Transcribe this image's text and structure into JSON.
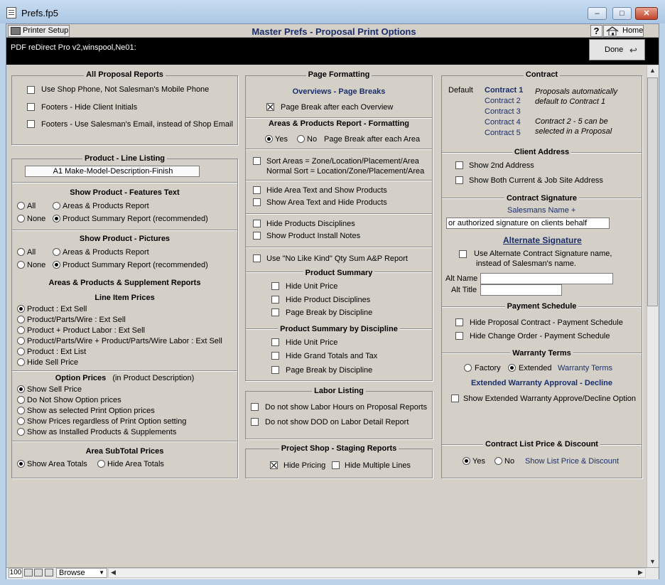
{
  "window": {
    "title": "Prefs.fp5",
    "minimize": "–",
    "maximize": "□",
    "close": "✕"
  },
  "toolbar": {
    "printer_setup": "Printer Setup",
    "page_title": "Master Prefs - Proposal Print Options",
    "help": "?",
    "home": "Home"
  },
  "header": {
    "printer_path": "PDF reDirect Pro v2,winspool,Ne01:",
    "done": "Done"
  },
  "col1": {
    "all_reports": {
      "title": "All Proposal Reports",
      "items": [
        {
          "label": "Use Shop Phone, Not Salesman's Mobile Phone",
          "checked": false
        },
        {
          "label": "Footers - Hide Client Initials",
          "checked": false
        },
        {
          "label": "Footers - Use Salesman's Email, instead of Shop Email",
          "checked": false
        }
      ]
    },
    "line_listing": {
      "title": "Product - Line Listing",
      "value": "A1 Make-Model-Description-Finish"
    },
    "features": {
      "title": "Show Product - Features Text",
      "opt_all": "All",
      "opt_areas": "Areas & Products Report",
      "opt_none": "None",
      "opt_summary": "Product Summary Report (recommended)",
      "selected": "summary"
    },
    "pictures": {
      "title": "Show Product - Pictures",
      "opt_all": "All",
      "opt_areas": "Areas & Products Report",
      "opt_none": "None",
      "opt_summary": "Product Summary Report (recommended)",
      "selected": "summary"
    },
    "supplement": {
      "title": "Areas & Products & Supplement Reports",
      "subtitle": "Line Item Prices",
      "options": [
        "Product : Ext Sell",
        "Product/Parts/Wire : Ext Sell",
        "Product + Product Labor : Ext Sell",
        "Product/Parts/Wire + Product/Parts/Wire Labor : Ext Sell",
        "Product : Ext List",
        "Hide Sell Price"
      ],
      "selected": 0
    },
    "option_prices": {
      "title": "Option Prices",
      "title_note": "(in Product Description)",
      "options": [
        "Show Sell Price",
        "Do Not Show Option prices",
        "Show as selected Print Option prices",
        "Show Prices regardless of Print Option setting",
        "Show as Installed Products & Supplements"
      ],
      "selected": 0
    },
    "subtotal": {
      "title": "Area SubTotal Prices",
      "opt_show": "Show Area Totals",
      "opt_hide": "Hide Area Totals",
      "selected": "show"
    }
  },
  "col2": {
    "page_format": {
      "title": "Page Formatting",
      "subtitle": "Overviews - Page Breaks",
      "page_break_overview": "Page Break after each Overview",
      "page_break_overview_checked": true
    },
    "ap_format": {
      "title": "Areas & Products Report - Formatting",
      "yes": "Yes",
      "no": "No",
      "page_break_area": "Page Break after each Area",
      "selected": "yes",
      "sort_line1": "Sort Areas = Zone/Location/Placement/Area",
      "sort_line2": "Normal Sort = Location/Zone/Placement/Area",
      "hide_area_text": "Hide Area Text and Show Products",
      "show_area_text": "Show Area Text and Hide Products",
      "hide_disciplines": "Hide Products Disciplines",
      "show_install_notes": "Show Product Install Notes",
      "no_like_kind": "Use \"No Like Kind\" Qty Sum A&P Report"
    },
    "summary": {
      "title": "Product Summary",
      "items": [
        "Hide Unit Price",
        "Hide Product Disciplines",
        "Page Break by Discipline"
      ]
    },
    "summary_disc": {
      "title": "Product Summary by Discipline",
      "items": [
        "Hide Unit Price",
        "Hide Grand Totals and Tax",
        "Page Break by Discipline"
      ]
    },
    "labor": {
      "title": "Labor Listing",
      "items": [
        "Do not show Labor Hours on Proposal Reports",
        "Do not show DOD on Labor Detail Report"
      ]
    },
    "staging": {
      "title": "Project Shop - Staging Reports",
      "hide_pricing": "Hide Pricing",
      "hide_pricing_checked": true,
      "hide_multiple": "Hide Multiple Lines"
    }
  },
  "col3": {
    "contract": {
      "title": "Contract",
      "default_label": "Default",
      "contracts": [
        "Contract 1",
        "Contract 2",
        "Contract 3",
        "Contract 4",
        "Contract 5"
      ],
      "note1": "Proposals automatically default to Contract 1",
      "note1a": "Proposals automatically",
      "note1b": "default to Contract 1",
      "note2a": "Contract 2 - 5 can be",
      "note2b": "selected in a Proposal"
    },
    "client_address": {
      "title": "Client Address",
      "items": [
        "Show 2nd Address",
        "Show Both Current & Job Site Address"
      ]
    },
    "signature": {
      "title": "Contract Signature",
      "salesman_label": "Salesmans Name  +",
      "sig_value": "or authorized signature on clients behalf",
      "alt_title": "Alternate Signature",
      "alt_use1": "Use Alternate Contract Signature name,",
      "alt_use2": "instead of Salesman's name.",
      "alt_name": "Alt Name",
      "alt_title_label": "Alt Title"
    },
    "payment": {
      "title": "Payment Schedule",
      "items": [
        "Hide Proposal Contract - Payment Schedule",
        "Hide Change Order - Payment Schedule"
      ]
    },
    "warranty": {
      "title": "Warranty Terms",
      "opt_factory": "Factory",
      "opt_extended": "Extended",
      "terms_label": "Warranty Terms",
      "selected": "extended",
      "approval_title": "Extended Warranty Approval - Decline",
      "approval_option": "Show Extended Warranty Approve/Decline Option"
    },
    "list_price": {
      "title": "Contract List Price & Discount",
      "yes": "Yes",
      "no": "No",
      "show_label": "Show List Price & Discount",
      "selected": "yes"
    }
  },
  "statusbar": {
    "zoom": "100",
    "mode": "Browse"
  }
}
